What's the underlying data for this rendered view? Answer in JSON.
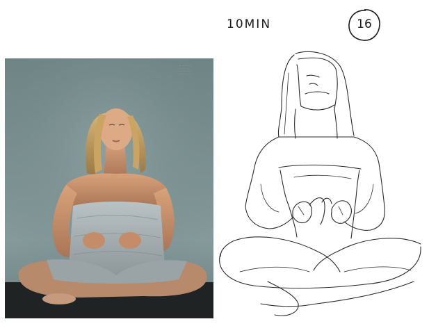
{
  "sketch_timer": {
    "duration": "10MIN",
    "number": "16"
  },
  "reference_photo": {
    "caption_lines": [
      "··· ···· ·· ····",
      "·· ······ ···",
      "···· ·· ·· ·····",
      "··· ···· ····· ··"
    ]
  },
  "colors": {
    "background": "#ffffff",
    "photo_wall": "#7d9292",
    "ink": "#1a1a1a",
    "towel": "#a9b2b6",
    "skin": "#c9956e"
  }
}
